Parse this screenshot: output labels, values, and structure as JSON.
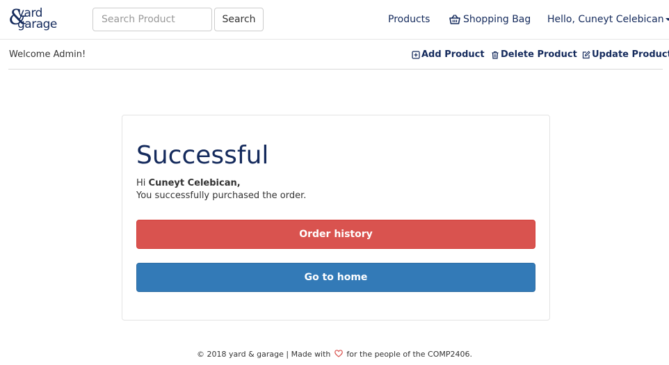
{
  "brand": {
    "logo_amp": "&",
    "logo_word1": "yard",
    "logo_word2": "garage",
    "color": "#142a5c"
  },
  "header": {
    "search_placeholder": "Search Product",
    "search_value": "",
    "search_button": "Search",
    "nav": {
      "products": "Products",
      "shopping_bag": "Shopping Bag",
      "user_menu": "Hello, Cuneyt Celebican"
    }
  },
  "admin": {
    "welcome": "Welcome Admin!",
    "add_product": "Add Product",
    "delete_product": "Delete Product",
    "update_product": "Update Product"
  },
  "confirmation": {
    "title": "Successful",
    "greeting_prefix": "Hi",
    "user_name": "Cuneyt Celebican,",
    "message": "You successfully purchased the order.",
    "order_history_button": "Order history",
    "home_button": "Go to home"
  },
  "footer": {
    "before_heart": "© 2018 yard & garage | Made with",
    "after_heart": "for the people of the COMP2406."
  },
  "icons": {
    "shopping_bag": "basket-icon",
    "add_product": "plus-square-icon",
    "delete_product": "trash-icon",
    "update_product": "edit-icon",
    "user_menu": "caret-down-icon",
    "footer": "heart-icon"
  },
  "colors": {
    "accent": "#142a5c",
    "danger": "#d9534f",
    "primary": "#337ab7",
    "heart": "#d9534f"
  }
}
